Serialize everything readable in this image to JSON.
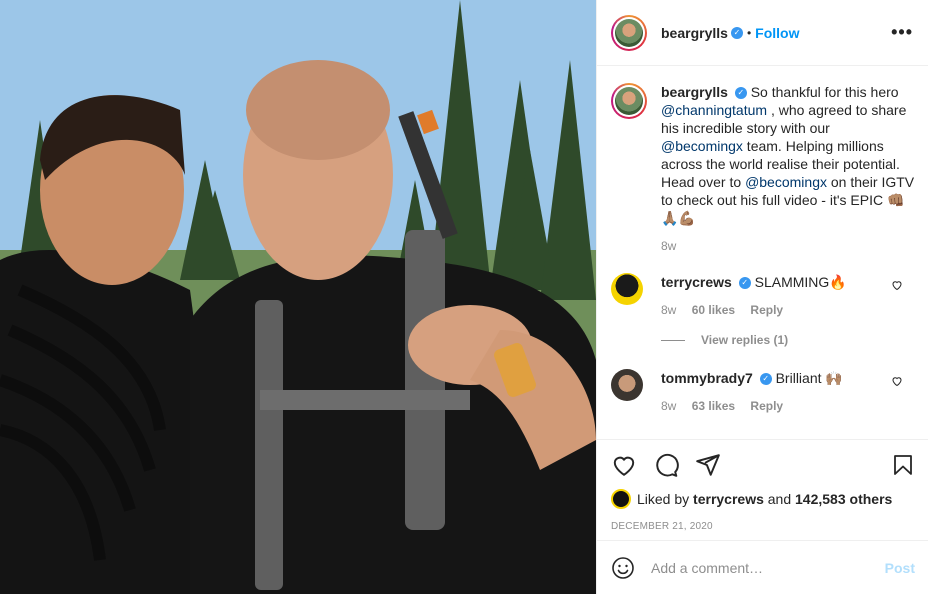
{
  "header": {
    "username": "beargrylls",
    "separator": "•",
    "follow_label": "Follow",
    "more_label": "•••"
  },
  "caption": {
    "username": "beargrylls",
    "text_1": "So thankful for this hero ",
    "mention_1": "@channingtatum",
    "text_2": " , who agreed to share his incredible story with our ",
    "mention_2": "@becomingx",
    "text_3": " team. Helping millions across the world realise their potential. Head over to ",
    "mention_3": "@becomingx",
    "text_4": " on their IGTV to check out his full video - it's EPIC 👊🏽🙏🏽💪🏽",
    "time": "8w"
  },
  "comments": [
    {
      "username": "terrycrews",
      "text": "SLAMMING🔥",
      "time": "8w",
      "likes": "60 likes",
      "reply_label": "Reply",
      "view_replies": "View replies (1)",
      "avatar_color": "#f5d300"
    },
    {
      "username": "tommybrady7",
      "text": "Brilliant 🙌🏽",
      "time": "8w",
      "likes": "63 likes",
      "reply_label": "Reply",
      "avatar_color": "#3b3530"
    }
  ],
  "likes_line": {
    "prefix": "Liked by",
    "user": "terrycrews",
    "middle": "and",
    "count": "142,583 others"
  },
  "date": "DECEMBER 21, 2020",
  "add_comment": {
    "placeholder": "Add a comment…",
    "post_label": "Post"
  },
  "colors": {
    "accent": "#0095f6",
    "verified": "#3897f0",
    "muted": "#8e8e8e"
  },
  "icons": [
    "verified-icon",
    "more-icon",
    "heart-icon",
    "comment-icon",
    "share-icon",
    "save-icon",
    "emoji-icon"
  ]
}
